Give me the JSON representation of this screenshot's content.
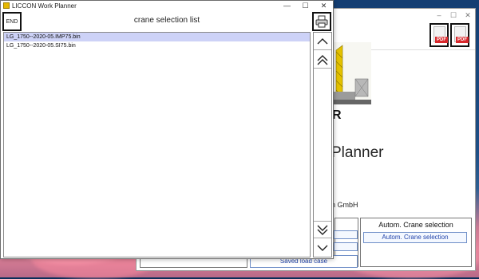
{
  "main_window": {
    "planner_text": "Planner",
    "company_text": "n GmbH",
    "brand_fragment": "R",
    "autom_title": "Autom. Crane selection",
    "autom_button": "Autom. Crane selection",
    "saved_button": "Saved load case",
    "pdf_label_1": "PDF",
    "pdf_label_2": "PDF",
    "win_min": "–",
    "win_max": "☐",
    "win_close": "✕"
  },
  "dialog": {
    "app_title": "LICCON Work Planner",
    "end_label": "END",
    "heading": "crane selection list",
    "items": [
      "LG_1750--2020-05.IMP75.bin",
      "LG_1750--2020-05.SI75.bin"
    ],
    "selected_index": 0,
    "controls": {
      "minimize": "—",
      "maximize": "☐",
      "close": "✕"
    }
  },
  "colors": {
    "selection": "#cdd2f7",
    "link_blue": "#2244aa",
    "pdf_red": "#d8282c"
  },
  "icons": [
    "app-icon",
    "printer-icon",
    "pdf-icon",
    "arrow-up-icon",
    "double-arrow-up-icon",
    "double-arrow-down-icon",
    "arrow-down-icon"
  ]
}
